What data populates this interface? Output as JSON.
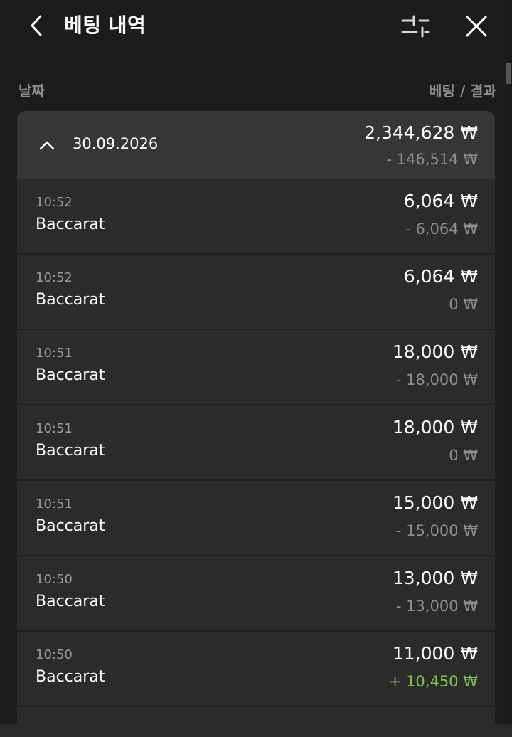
{
  "header": {
    "title": "베팅 내역",
    "back_icon": "chevron-left-icon",
    "filter_icon": "sliders-icon",
    "close_icon": "close-icon"
  },
  "columns": {
    "date": "날짜",
    "bet_result": "베팅 / 결과"
  },
  "group": {
    "date": "30.09.2026",
    "total": "2,344,628 ₩",
    "result": "- 146,514 ₩",
    "expanded": true
  },
  "rows": [
    {
      "time": "10:52",
      "game": "Baccarat",
      "amount": "6,064 ₩",
      "result": "- 6,064 ₩",
      "status": "loss"
    },
    {
      "time": "10:52",
      "game": "Baccarat",
      "amount": "6,064 ₩",
      "result": "0 ₩",
      "status": "neutral"
    },
    {
      "time": "10:51",
      "game": "Baccarat",
      "amount": "18,000 ₩",
      "result": "- 18,000 ₩",
      "status": "loss"
    },
    {
      "time": "10:51",
      "game": "Baccarat",
      "amount": "18,000 ₩",
      "result": "0 ₩",
      "status": "neutral"
    },
    {
      "time": "10:51",
      "game": "Baccarat",
      "amount": "15,000 ₩",
      "result": "- 15,000 ₩",
      "status": "loss"
    },
    {
      "time": "10:50",
      "game": "Baccarat",
      "amount": "13,000 ₩",
      "result": "- 13,000 ₩",
      "status": "loss"
    },
    {
      "time": "10:50",
      "game": "Baccarat",
      "amount": "11,000 ₩",
      "result": "+ 10,450 ₩",
      "status": "win"
    }
  ],
  "colors": {
    "background": "#1c1c1c",
    "card": "#2b2b2b",
    "group_header": "#363636",
    "win": "#7bc64a",
    "muted": "#8e8e8e"
  }
}
